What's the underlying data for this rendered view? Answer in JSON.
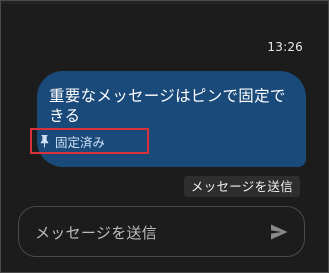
{
  "conversation": {
    "timestamp": "13:26",
    "message": {
      "text": "重要なメッセージはピンで固定できる",
      "pin_label": "固定済み",
      "pin_icon": "pin-icon",
      "bubble_color": "#1a4a7a"
    }
  },
  "tooltip": {
    "text": "メッセージを送信"
  },
  "composer": {
    "placeholder": "メッセージを送信",
    "send_icon": "send-icon"
  },
  "colors": {
    "highlight": "#d6333b",
    "background": "#1c1c1c"
  }
}
